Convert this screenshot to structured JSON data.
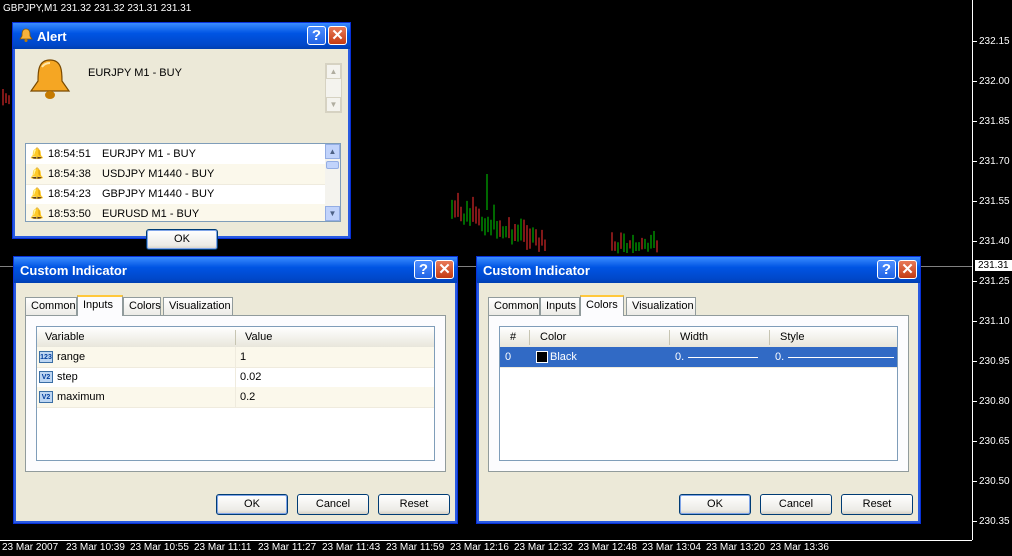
{
  "chart": {
    "title": "GBPJPY,M1  231.32 231.32 231.31 231.31",
    "prices": [
      "232.15",
      "232.00",
      "231.85",
      "231.70",
      "231.55",
      "231.40",
      "231.25",
      "231.10",
      "230.95",
      "230.80",
      "230.65",
      "230.50",
      "230.35"
    ],
    "current_price": "231.31",
    "times": [
      "23 Mar 2007",
      "23 Mar 10:39",
      "23 Mar 10:55",
      "23 Mar 11:11",
      "23 Mar 11:27",
      "23 Mar 11:43",
      "23 Mar 11:59",
      "23 Mar 12:16",
      "23 Mar 12:32",
      "23 Mar 12:48",
      "23 Mar 13:04",
      "23 Mar 13:20",
      "23 Mar 13:36"
    ]
  },
  "alert": {
    "title": "Alert",
    "message": "EURJPY M1 - BUY",
    "rows": [
      {
        "time": "18:54:51",
        "text": "EURJPY M1 - BUY"
      },
      {
        "time": "18:54:38",
        "text": "USDJPY M1440 - BUY"
      },
      {
        "time": "18:54:23",
        "text": "GBPJPY M1440 - BUY"
      },
      {
        "time": "18:53:50",
        "text": "EURUSD M1 - BUY"
      }
    ],
    "ok_label": "OK"
  },
  "ci_inputs": {
    "title": "Custom Indicator",
    "tabs": [
      "Common",
      "Inputs",
      "Colors",
      "Visualization"
    ],
    "columns": [
      "Variable",
      "Value"
    ],
    "rows": [
      {
        "icon": "123",
        "name": "range",
        "value": "1"
      },
      {
        "icon": "V2",
        "name": "step",
        "value": "0.02"
      },
      {
        "icon": "V2",
        "name": "maximum",
        "value": "0.2"
      }
    ],
    "buttons": {
      "ok": "OK",
      "cancel": "Cancel",
      "reset": "Reset"
    }
  },
  "ci_colors": {
    "title": "Custom Indicator",
    "tabs": [
      "Common",
      "Inputs",
      "Colors",
      "Visualization"
    ],
    "columns": [
      "#",
      "Color",
      "Width",
      "Style"
    ],
    "row": {
      "index": "0",
      "color": "Black",
      "width": "0.",
      "style": "0."
    },
    "buttons": {
      "ok": "OK",
      "cancel": "Cancel",
      "reset": "Reset"
    }
  }
}
